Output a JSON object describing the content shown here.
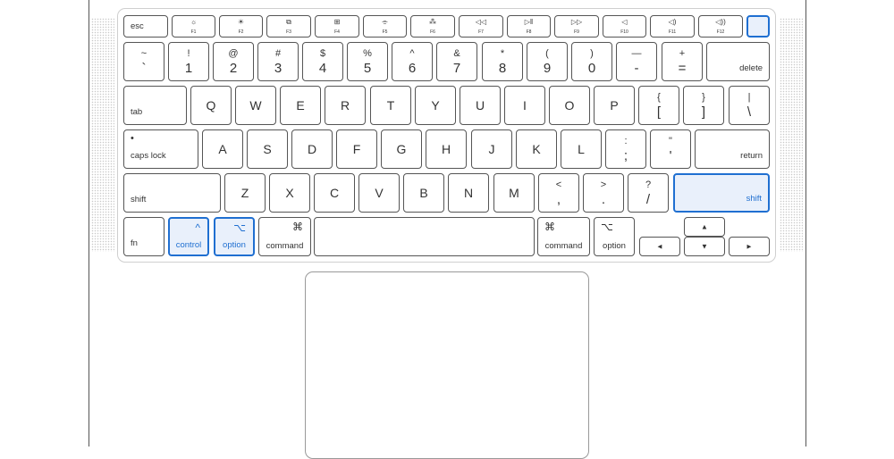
{
  "function_row": [
    {
      "id": "esc",
      "label": "esc"
    },
    {
      "id": "f1",
      "label": "F1",
      "icon": "brightness-down-icon",
      "glyph": "☼"
    },
    {
      "id": "f2",
      "label": "F2",
      "icon": "brightness-up-icon",
      "glyph": "☀"
    },
    {
      "id": "f3",
      "label": "F3",
      "icon": "mission-control-icon",
      "glyph": "⧉"
    },
    {
      "id": "f4",
      "label": "F4",
      "icon": "launchpad-icon",
      "glyph": "⊞"
    },
    {
      "id": "f5",
      "label": "F5",
      "icon": "keyboard-brightness-down-icon",
      "glyph": "⌯"
    },
    {
      "id": "f6",
      "label": "F6",
      "icon": "keyboard-brightness-up-icon",
      "glyph": "⁂"
    },
    {
      "id": "f7",
      "label": "F7",
      "icon": "rewind-icon",
      "glyph": "◁◁"
    },
    {
      "id": "f8",
      "label": "F8",
      "icon": "play-pause-icon",
      "glyph": "▷‖"
    },
    {
      "id": "f9",
      "label": "F9",
      "icon": "fast-forward-icon",
      "glyph": "▷▷"
    },
    {
      "id": "f10",
      "label": "F10",
      "icon": "mute-icon",
      "glyph": "◁"
    },
    {
      "id": "f11",
      "label": "F11",
      "icon": "volume-down-icon",
      "glyph": "◁)"
    },
    {
      "id": "f12",
      "label": "F12",
      "icon": "volume-up-icon",
      "glyph": "◁))"
    },
    {
      "id": "power",
      "label": "",
      "icon": "power-touch-id-icon",
      "highlighted": true
    }
  ],
  "number_row": [
    {
      "top": "~",
      "bottom": "`"
    },
    {
      "top": "!",
      "bottom": "1"
    },
    {
      "top": "@",
      "bottom": "2"
    },
    {
      "top": "#",
      "bottom": "3"
    },
    {
      "top": "$",
      "bottom": "4"
    },
    {
      "top": "%",
      "bottom": "5"
    },
    {
      "top": "^",
      "bottom": "6"
    },
    {
      "top": "&",
      "bottom": "7"
    },
    {
      "top": "*",
      "bottom": "8"
    },
    {
      "top": "(",
      "bottom": "9"
    },
    {
      "top": ")",
      "bottom": "0"
    },
    {
      "top": "—",
      "bottom": "-"
    },
    {
      "top": "+",
      "bottom": "="
    }
  ],
  "delete_label": "delete",
  "tab_label": "tab",
  "qwerty_row": [
    "Q",
    "W",
    "E",
    "R",
    "T",
    "Y",
    "U",
    "I",
    "O",
    "P"
  ],
  "qwerty_symbols": [
    {
      "top": "{",
      "bottom": "["
    },
    {
      "top": "}",
      "bottom": "]"
    },
    {
      "top": "|",
      "bottom": "\\"
    }
  ],
  "caps_lock": {
    "indicator": "•",
    "label": "caps lock"
  },
  "home_row": [
    "A",
    "S",
    "D",
    "F",
    "G",
    "H",
    "J",
    "K",
    "L"
  ],
  "home_symbols": [
    {
      "top": ":",
      "bottom": ";"
    },
    {
      "top": "\"",
      "bottom": "'"
    }
  ],
  "return_label": "return",
  "shift_left_label": "shift",
  "bottom_letters": [
    "Z",
    "X",
    "C",
    "V",
    "B",
    "N",
    "M"
  ],
  "bottom_symbols": [
    {
      "top": "<",
      "bottom": ","
    },
    {
      "top": ">",
      "bottom": "."
    },
    {
      "top": "?",
      "bottom": "/"
    }
  ],
  "shift_right": {
    "label": "shift",
    "highlighted": true
  },
  "modifier_row": {
    "fn": {
      "label": "fn"
    },
    "control_left": {
      "label": "control",
      "symbol": "^",
      "highlighted": true
    },
    "option_left": {
      "label": "option",
      "symbol": "⌥",
      "highlighted": true
    },
    "command_left": {
      "label": "command",
      "symbol": "⌘"
    },
    "command_right": {
      "label": "command",
      "symbol": "⌘"
    },
    "option_right": {
      "label": "option",
      "symbol": "⌥"
    }
  },
  "arrows": {
    "left": "◄",
    "up": "▲",
    "down": "▼",
    "right": "►"
  },
  "colors": {
    "highlight_border": "#1f6fd1",
    "highlight_fill": "#e9f0fb",
    "key_border": "#555555"
  }
}
